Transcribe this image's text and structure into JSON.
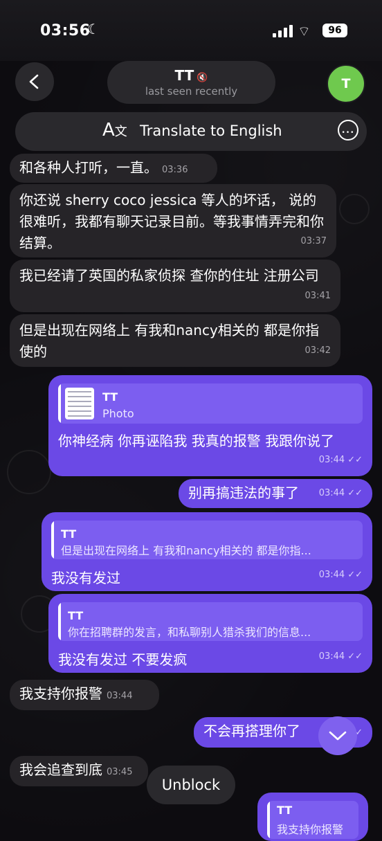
{
  "status": {
    "time": "03:56",
    "moon": "☾",
    "battery": "96",
    "wifi": "⌔"
  },
  "header": {
    "back_icon": "chevron-left-icon",
    "name": "TT",
    "mute_icon": "🔇",
    "subtitle": "last seen recently",
    "avatar_letter": "T",
    "avatar_color": "#6fc94e"
  },
  "translate": {
    "icon": "文",
    "label": "Translate to English",
    "more_icon": "•••"
  },
  "messages": [
    {
      "side": "in",
      "text": "和各种人打听，一直。",
      "time": "03:36"
    },
    {
      "side": "in",
      "text": "你还说 sherry coco jessica 等人的坏话， 说的很难听，我都有聊天记录目前。等我事情弄完和你结算。",
      "time": "03:37"
    },
    {
      "side": "in",
      "text": "我已经请了英国的私家侦探 查你的住址 注册公司",
      "time": "03:41"
    },
    {
      "side": "in",
      "text": "但是出现在网络上 有我和nancy相关的 都是你指使的",
      "time": "03:42"
    },
    {
      "side": "out",
      "reply_name": "TT",
      "reply_text": "Photo",
      "text": "你神经病 你再诬陷我 我真的报警 我跟你说了",
      "time": "03:44"
    },
    {
      "side": "out",
      "text": "别再搞违法的事了",
      "time": "03:44"
    },
    {
      "side": "out",
      "reply_name": "TT",
      "reply_text": "但是出现在网络上 有我和nancy相关的 都是你指...",
      "text": "我没有发过",
      "time": "03:44"
    },
    {
      "side": "out",
      "reply_name": "TT",
      "reply_text": "你在招聘群的发言，和私聊别人猎杀我们的信息...",
      "text": "我没有发过 不要发疯",
      "time": "03:44"
    },
    {
      "side": "in",
      "text": "我支持你报警",
      "time": "03:44"
    },
    {
      "side": "out",
      "text": "不会再搭理你了",
      "time": ""
    },
    {
      "side": "in",
      "text": "我会追查到底",
      "time": "03:45"
    },
    {
      "side": "out",
      "reply_name": "TT",
      "reply_text": "我支持你报警",
      "text": "",
      "time": ""
    }
  ],
  "checkmark": "✓✓",
  "scroll_icon": "chevron-down-icon",
  "unblock_label": "Unblock"
}
